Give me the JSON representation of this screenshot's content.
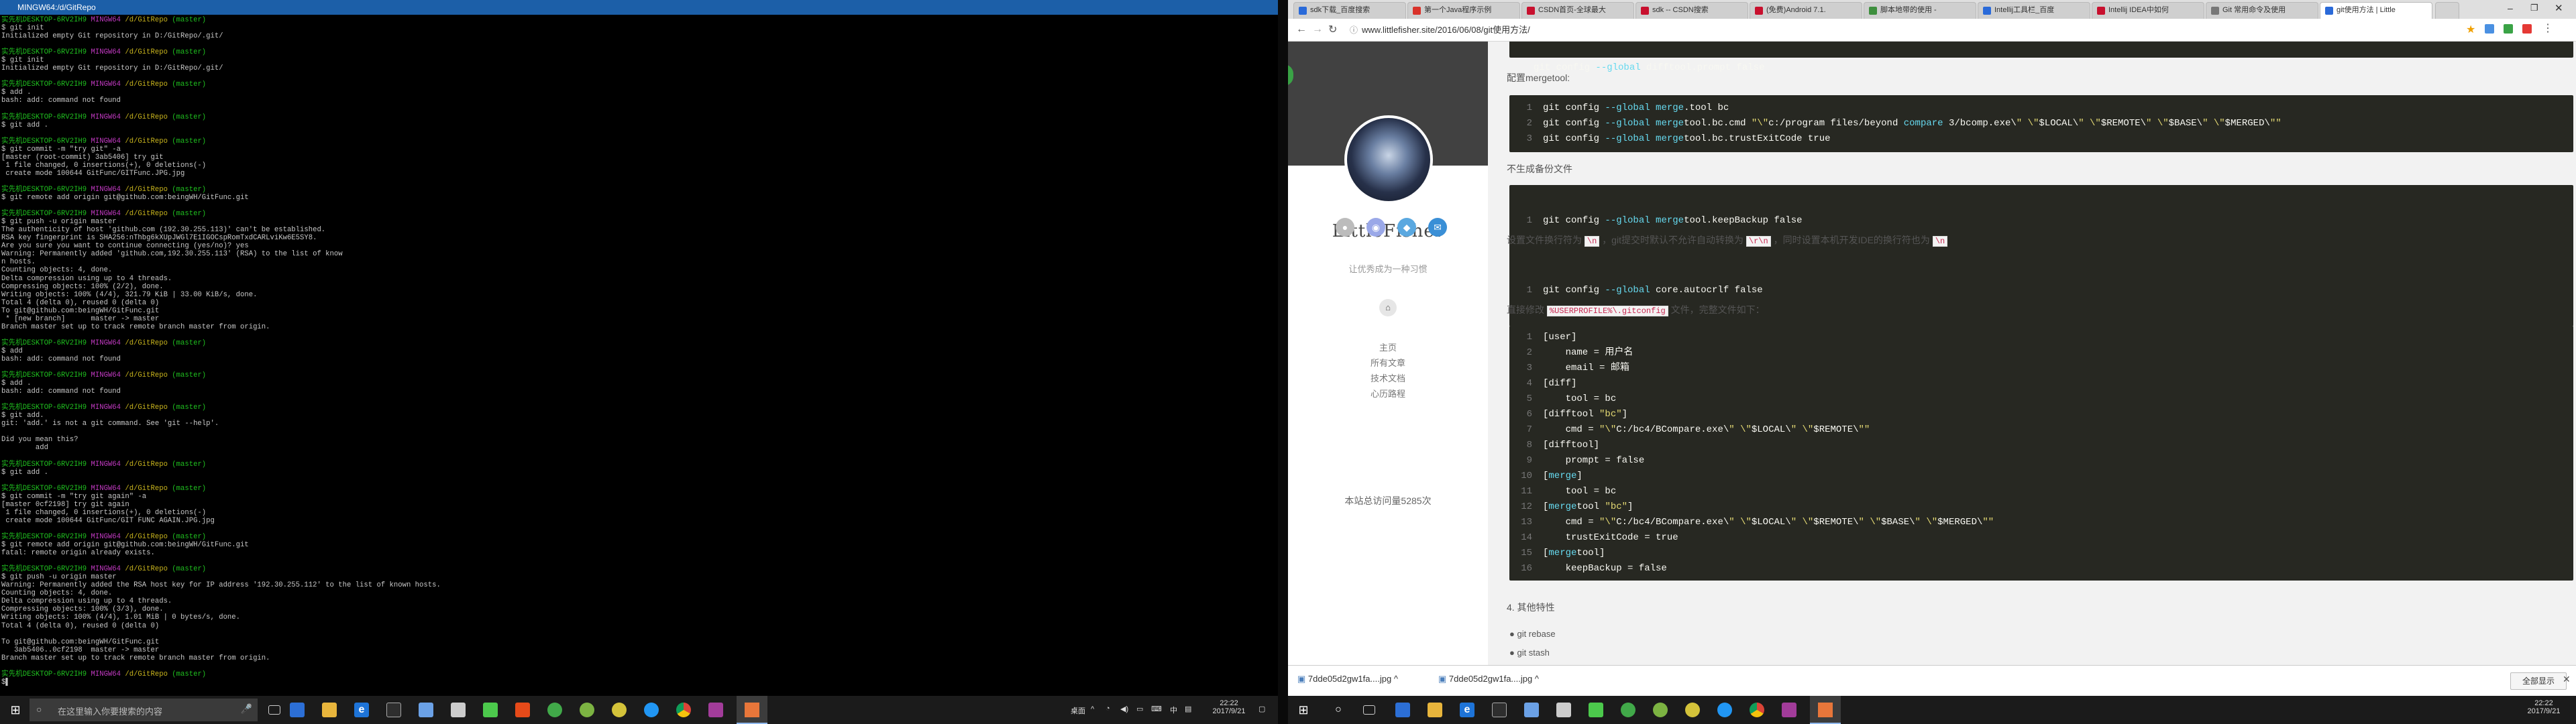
{
  "terminal": {
    "title": "MINGW64:/d/GitRepo",
    "lines": [
      [
        [
          "g",
          "实先机DESKTOP-6RV2IH9 "
        ],
        [
          "m",
          "MINGW64 "
        ],
        [
          "y",
          "/d/GitRepo "
        ],
        [
          "g",
          "(master)"
        ]
      ],
      [
        [
          "w",
          "$ git init"
        ]
      ],
      [
        [
          "w",
          "Initialized empty Git repository in D:/GitRepo/.git/"
        ]
      ],
      [
        [
          "w",
          ""
        ]
      ],
      [
        [
          "g",
          "实先机DESKTOP-6RV2IH9 "
        ],
        [
          "m",
          "MINGW64 "
        ],
        [
          "y",
          "/d/GitRepo "
        ],
        [
          "g",
          "(master)"
        ]
      ],
      [
        [
          "w",
          "$ git init"
        ]
      ],
      [
        [
          "w",
          "Initialized empty Git repository in D:/GitRepo/.git/"
        ]
      ],
      [
        [
          "w",
          ""
        ]
      ],
      [
        [
          "g",
          "实先机DESKTOP-6RV2IH9 "
        ],
        [
          "m",
          "MINGW64 "
        ],
        [
          "y",
          "/d/GitRepo "
        ],
        [
          "g",
          "(master)"
        ]
      ],
      [
        [
          "w",
          "$ add ."
        ]
      ],
      [
        [
          "w",
          "bash: add: command not found"
        ]
      ],
      [
        [
          "w",
          ""
        ]
      ],
      [
        [
          "g",
          "实先机DESKTOP-6RV2IH9 "
        ],
        [
          "m",
          "MINGW64 "
        ],
        [
          "y",
          "/d/GitRepo "
        ],
        [
          "g",
          "(master)"
        ]
      ],
      [
        [
          "w",
          "$ git add ."
        ]
      ],
      [
        [
          "w",
          ""
        ]
      ],
      [
        [
          "g",
          "实先机DESKTOP-6RV2IH9 "
        ],
        [
          "m",
          "MINGW64 "
        ],
        [
          "y",
          "/d/GitRepo "
        ],
        [
          "g",
          "(master)"
        ]
      ],
      [
        [
          "w",
          "$ git commit -m \"try git\" -a"
        ]
      ],
      [
        [
          "w",
          "[master (root-commit) 3ab5406] try git"
        ]
      ],
      [
        [
          "w",
          " 1 file changed, 0 insertions(+), 0 deletions(-)"
        ]
      ],
      [
        [
          "w",
          " create mode 100644 GitFunc/GITFunc.JPG.jpg"
        ]
      ],
      [
        [
          "w",
          ""
        ]
      ],
      [
        [
          "g",
          "实先机DESKTOP-6RV2IH9 "
        ],
        [
          "m",
          "MINGW64 "
        ],
        [
          "y",
          "/d/GitRepo "
        ],
        [
          "g",
          "(master)"
        ]
      ],
      [
        [
          "w",
          "$ git remote add origin git@github.com:beingWH/GitFunc.git"
        ]
      ],
      [
        [
          "w",
          ""
        ]
      ],
      [
        [
          "g",
          "实先机DESKTOP-6RV2IH9 "
        ],
        [
          "m",
          "MINGW64 "
        ],
        [
          "y",
          "/d/GitRepo "
        ],
        [
          "g",
          "(master)"
        ]
      ],
      [
        [
          "w",
          "$ git push -u origin master"
        ]
      ],
      [
        [
          "w",
          "The authenticity of host 'github.com (192.30.255.113)' can't be established."
        ]
      ],
      [
        [
          "w",
          "RSA key fingerprint is SHA256:nThbg6kXUpJWGl7E1IGOCspRomTxdCARLviKw6E5SY8."
        ]
      ],
      [
        [
          "w",
          "Are you sure you want to continue connecting (yes/no)? yes"
        ]
      ],
      [
        [
          "w",
          "Warning: Permanently added 'github.com,192.30.255.113' (RSA) to the list of know"
        ]
      ],
      [
        [
          "w",
          "n hosts."
        ]
      ],
      [
        [
          "w",
          "Counting objects: 4, done."
        ]
      ],
      [
        [
          "w",
          "Delta compression using up to 4 threads."
        ]
      ],
      [
        [
          "w",
          "Compressing objects: 100% (2/2), done."
        ]
      ],
      [
        [
          "w",
          "Writing objects: 100% (4/4), 321.79 KiB | 33.00 KiB/s, done."
        ]
      ],
      [
        [
          "w",
          "Total 4 (delta 0), reused 0 (delta 0)"
        ]
      ],
      [
        [
          "w",
          "To git@github.com:beingWH/GitFunc.git"
        ]
      ],
      [
        [
          "w",
          " * [new branch]      master -> master"
        ]
      ],
      [
        [
          "w",
          "Branch master set up to track remote branch master from origin."
        ]
      ],
      [
        [
          "w",
          ""
        ]
      ],
      [
        [
          "g",
          "实先机DESKTOP-6RV2IH9 "
        ],
        [
          "m",
          "MINGW64 "
        ],
        [
          "y",
          "/d/GitRepo "
        ],
        [
          "g",
          "(master)"
        ]
      ],
      [
        [
          "w",
          "$ add"
        ]
      ],
      [
        [
          "w",
          "bash: add: command not found"
        ]
      ],
      [
        [
          "w",
          ""
        ]
      ],
      [
        [
          "g",
          "实先机DESKTOP-6RV2IH9 "
        ],
        [
          "m",
          "MINGW64 "
        ],
        [
          "y",
          "/d/GitRepo "
        ],
        [
          "g",
          "(master)"
        ]
      ],
      [
        [
          "w",
          "$ add ."
        ]
      ],
      [
        [
          "w",
          "bash: add: command not found"
        ]
      ],
      [
        [
          "w",
          ""
        ]
      ],
      [
        [
          "g",
          "实先机DESKTOP-6RV2IH9 "
        ],
        [
          "m",
          "MINGW64 "
        ],
        [
          "y",
          "/d/GitRepo "
        ],
        [
          "g",
          "(master)"
        ]
      ],
      [
        [
          "w",
          "$ git add."
        ]
      ],
      [
        [
          "w",
          "git: 'add.' is not a git command. See 'git --help'."
        ]
      ],
      [
        [
          "w",
          ""
        ]
      ],
      [
        [
          "w",
          "Did you mean this?"
        ]
      ],
      [
        [
          "w",
          "        add"
        ]
      ],
      [
        [
          "w",
          ""
        ]
      ],
      [
        [
          "g",
          "实先机DESKTOP-6RV2IH9 "
        ],
        [
          "m",
          "MINGW64 "
        ],
        [
          "y",
          "/d/GitRepo "
        ],
        [
          "g",
          "(master)"
        ]
      ],
      [
        [
          "w",
          "$ git add ."
        ]
      ],
      [
        [
          "w",
          ""
        ]
      ],
      [
        [
          "g",
          "实先机DESKTOP-6RV2IH9 "
        ],
        [
          "m",
          "MINGW64 "
        ],
        [
          "y",
          "/d/GitRepo "
        ],
        [
          "g",
          "(master)"
        ]
      ],
      [
        [
          "w",
          "$ git commit -m \"try git again\" -a"
        ]
      ],
      [
        [
          "w",
          "[master 0cf2198] try git again"
        ]
      ],
      [
        [
          "w",
          " 1 file changed, 0 insertions(+), 0 deletions(-)"
        ]
      ],
      [
        [
          "w",
          " create mode 100644 GitFunc/GIT FUNC AGAIN.JPG.jpg"
        ]
      ],
      [
        [
          "w",
          ""
        ]
      ],
      [
        [
          "g",
          "实先机DESKTOP-6RV2IH9 "
        ],
        [
          "m",
          "MINGW64 "
        ],
        [
          "y",
          "/d/GitRepo "
        ],
        [
          "g",
          "(master)"
        ]
      ],
      [
        [
          "w",
          "$ git remote add origin git@github.com:beingWH/GitFunc.git"
        ]
      ],
      [
        [
          "w",
          "fatal: remote origin already exists."
        ]
      ],
      [
        [
          "w",
          ""
        ]
      ],
      [
        [
          "g",
          "实先机DESKTOP-6RV2IH9 "
        ],
        [
          "m",
          "MINGW64 "
        ],
        [
          "y",
          "/d/GitRepo "
        ],
        [
          "g",
          "(master)"
        ]
      ],
      [
        [
          "w",
          "$ git push -u origin master"
        ]
      ],
      [
        [
          "w",
          "Warning: Permanently added the RSA host key for IP address '192.30.255.112' to the list of known hosts."
        ]
      ],
      [
        [
          "w",
          "Counting objects: 4, done."
        ]
      ],
      [
        [
          "w",
          "Delta compression using up to 4 threads."
        ]
      ],
      [
        [
          "w",
          "Compressing objects: 100% (3/3), done."
        ]
      ],
      [
        [
          "w",
          "Writing objects: 100% (4/4), 1.01 MiB | 0 bytes/s, done."
        ]
      ],
      [
        [
          "w",
          "Total 4 (delta 0), reused 0 (delta 0)"
        ]
      ],
      [
        [
          "w",
          ""
        ]
      ],
      [
        [
          "w",
          "To git@github.com:beingWH/GitFunc.git"
        ]
      ],
      [
        [
          "w",
          "   3ab5406..0cf2198  master -> master"
        ]
      ],
      [
        [
          "w",
          "Branch master set up to track remote branch master from origin."
        ]
      ],
      [
        [
          "w",
          ""
        ]
      ],
      [
        [
          "g",
          "实先机DESKTOP-6RV2IH9 "
        ],
        [
          "m",
          "MINGW64 "
        ],
        [
          "y",
          "/d/GitRepo "
        ],
        [
          "g",
          "(master)"
        ]
      ],
      [
        [
          "w",
          "$"
        ]
      ]
    ]
  },
  "taskbar_left": {
    "search_placeholder": "在这里输入你要搜索的内容",
    "tray_label": "桌面",
    "ime": "中",
    "time": "22:22",
    "date": "2017/9/21"
  },
  "taskbar_right": {
    "time": "22:22",
    "date": "2017/9/21"
  },
  "browser": {
    "tabs": [
      {
        "label": "sdk下载_百度搜索",
        "color": "#2a6ad9"
      },
      {
        "label": "第一个Java程序示例",
        "color": "#d9322a"
      },
      {
        "label": "CSDN首页-全球最大",
        "color": "#c8102e"
      },
      {
        "label": "sdk -- CSDN搜索",
        "color": "#c8102e"
      },
      {
        "label": "(免费)Android 7.1.",
        "color": "#c8102e"
      },
      {
        "label": "脚本地带的使用 -",
        "color": "#3e8f3e"
      },
      {
        "label": "Intellij工具栏_百度",
        "color": "#2a6ad9"
      },
      {
        "label": "Intellij IDEA中如何",
        "color": "#c8102e"
      },
      {
        "label": "Git 常用命令及使用",
        "color": "#777777"
      },
      {
        "label": "git使用方法 | Little",
        "color": "#2a6ad9"
      }
    ],
    "url": "www.littlefisher.site/2016/06/08/git使用方法/",
    "sidebar": {
      "site_name": "LittleFisher",
      "motto": "让优秀成为一种习惯",
      "links": [
        "主页",
        "所有文章",
        "技术文档",
        "心历路程"
      ],
      "visits": "本站总访问量5285次"
    },
    "article": {
      "top_code": "git config --global difftool.prompt false",
      "mergetool_title": "配置mergetool:",
      "mergetool_code": [
        "git config --global merge.tool bc",
        "git config --global mergetool.bc.cmd \"\\\"c:/program files/beyond compare 3/bcomp.exe\\\" \\\"$LOCAL\\\" \\\"$REMOTE\\\" \\\"$BASE\\\" \\\"$MERGED\\\"\"",
        "git config --global mergetool.bc.trustExitCode true"
      ],
      "backup_title": "不生成备份文件",
      "backup_code": "git config --global mergetool.keepBackup false",
      "crlf_text_a": "设置文件换行符为",
      "crlf_code_a": "\\n",
      "crlf_text_b": "，git提交时默认不允许自动转换为",
      "crlf_code_b": "\\r\\n",
      "crlf_text_c": "，同时设置本机开发IDE的换行符也为",
      "crlf_code_c": "\\n",
      "crlf_code": "git config --global core.autocrlf false",
      "direct_text_a": "直接修改",
      "direct_code": "%USERPROFILE%\\.gitconfig",
      "direct_text_b": "文件，完整文件如下：",
      "gitconfig": [
        "[user]",
        "    name = 用户名",
        "    email = 邮箱",
        "[diff]",
        "    tool = bc",
        "[difftool \"bc\"]",
        "    cmd = \"\\\"C:/bc4/BCompare.exe\\\" \\\"$LOCAL\\\" \\\"$REMOTE\\\"\"",
        "[difftool]",
        "    prompt = false",
        "[merge]",
        "    tool = bc",
        "[mergetool \"bc\"]",
        "    cmd = \"\\\"C:/bc4/BCompare.exe\\\" \\\"$LOCAL\\\" \\\"$REMOTE\\\" \\\"$BASE\\\" \\\"$MERGED\\\"\"",
        "    trustExitCode = true",
        "[mergetool]",
        "    keepBackup = false"
      ],
      "section4": "4.  其他特性",
      "bullets": [
        "git rebase",
        "git stash"
      ]
    },
    "downloads": [
      "7dde05d2gw1fa....jpg",
      "7dde05d2gw1fa....jpg"
    ],
    "show_all": "全部显示"
  }
}
